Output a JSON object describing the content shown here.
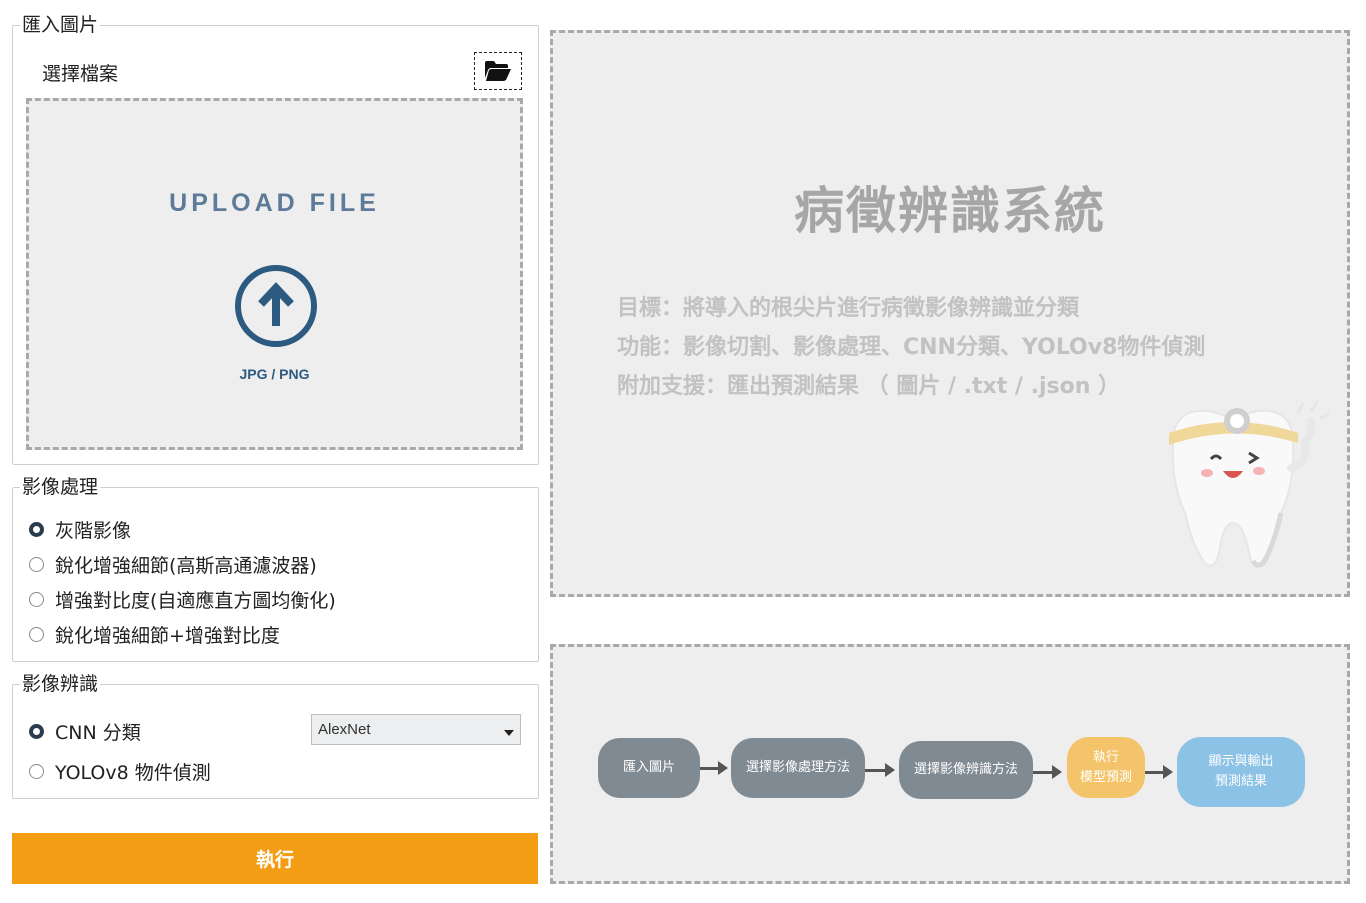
{
  "import_group": {
    "legend": "匯入圖片",
    "choose_label": "選擇檔案",
    "folder_icon": "folder-open-icon",
    "upload_title": "UPLOAD FILE",
    "upload_types": "JPG / PNG"
  },
  "processing_group": {
    "legend": "影像處理",
    "options": [
      {
        "label": "灰階影像",
        "checked": true
      },
      {
        "label": "銳化增強細節(高斯高通濾波器)",
        "checked": false
      },
      {
        "label": "增強對比度(自適應直方圖均衡化)",
        "checked": false
      },
      {
        "label": "銳化增強細節+增強對比度",
        "checked": false
      }
    ]
  },
  "recognition_group": {
    "legend": "影像辨識",
    "options": [
      {
        "label": "CNN 分類",
        "checked": true
      },
      {
        "label": "YOLOv8 物件偵測",
        "checked": false
      }
    ],
    "model_select": "AlexNet"
  },
  "run_button": "執行",
  "info": {
    "title": "病徵辨識系統",
    "lines": [
      "目標：將導入的根尖片進行病徵影像辨識並分類",
      "功能：影像切割、影像處理、CNN分類、YOLOv8物件偵測",
      "附加支援：匯出預測結果 （ 圖片 / .txt  / .json ）"
    ]
  },
  "flow": {
    "steps": [
      "匯入圖片",
      "選擇影像處理方法",
      "選擇影像辨識方法",
      "執行\n模型預測",
      "顯示與輸出\n預測結果"
    ]
  },
  "colors": {
    "accent": "#f29d13",
    "upload_title": "#5d7a99",
    "upload_icon": "#2d5a80",
    "flow_gray": "#7f8a93",
    "flow_orange": "#f3c46a",
    "flow_blue": "#8cc2e5"
  }
}
